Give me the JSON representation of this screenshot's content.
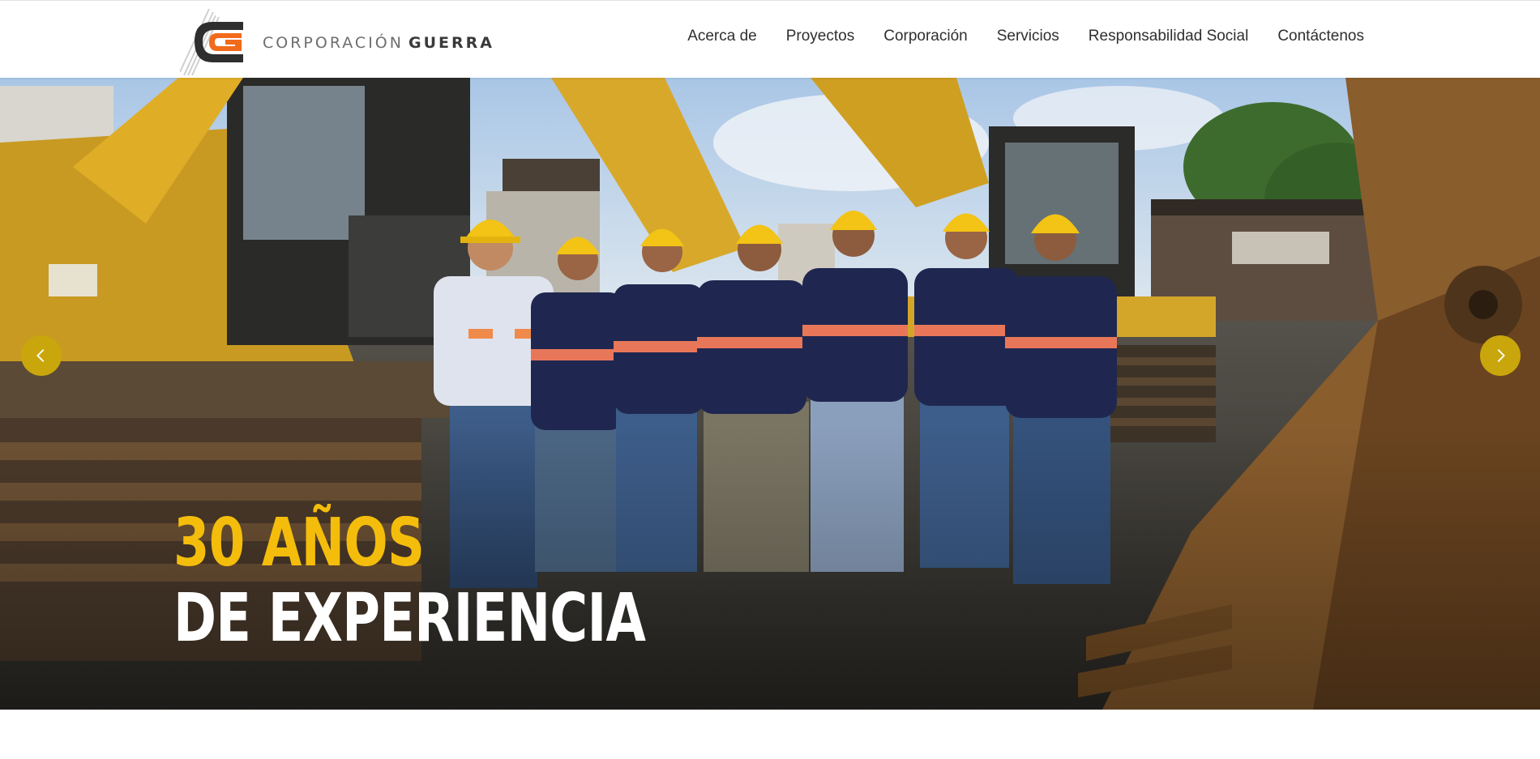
{
  "brand": {
    "name_light": "CORPORACIÓN",
    "name_bold": "GUERRA",
    "logo_icon": "cg-logo-icon",
    "colors": {
      "logo_orange": "#f26a1b",
      "logo_dark": "#2e2e2e",
      "accent_yellow": "#f4bd0b",
      "arrow_gold": "#c9a60c"
    }
  },
  "nav": {
    "items": [
      {
        "label": "Acerca de"
      },
      {
        "label": "Proyectos"
      },
      {
        "label": "Corporación"
      },
      {
        "label": "Servicios"
      },
      {
        "label": "Responsabilidad Social"
      },
      {
        "label": "Contáctenos"
      }
    ]
  },
  "hero": {
    "headline_line1": "30 AÑOS",
    "headline_line2": "DE EXPERIENCIA",
    "prev_icon": "chevron-left-icon",
    "next_icon": "chevron-right-icon",
    "image_subject": "team-with-excavators-photo"
  }
}
